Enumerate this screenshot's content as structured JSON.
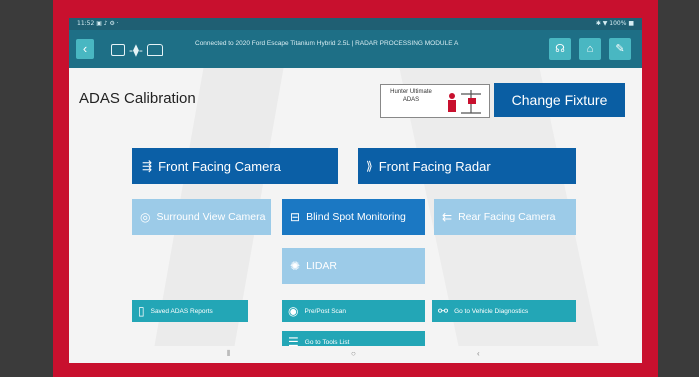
{
  "statusbar": {
    "left": "11:52 ▣ ♪ ⚙ ·",
    "right": "✱ ▼ 100% ■"
  },
  "header": {
    "back_glyph": "‹",
    "connection_text": "Connected to 2020 Ford Escape Titanium Hybrid 2.5L | RADAR PROCESSING MODULE A",
    "buttons": [
      {
        "icon": "headset-icon",
        "glyph": "☊"
      },
      {
        "icon": "home-icon",
        "glyph": "⌂"
      },
      {
        "icon": "report-icon",
        "glyph": "✎"
      }
    ]
  },
  "main": {
    "title": "ADAS Calibration",
    "fixture": {
      "label": "Hunter Ultimate ADAS",
      "change_label": "Change Fixture"
    },
    "buttons": {
      "front_camera": "Front Facing Camera",
      "front_radar": "Front Facing Radar",
      "surround_view": "Surround View Camera",
      "blind_spot": "Blind Spot Monitoring",
      "rear_camera": "Rear Facing Camera",
      "lidar": "LIDAR",
      "saved_reports": "Saved ADAS Reports",
      "pre_post_scan": "Pre/Post Scan",
      "vehicle_diagnostics": "Go to Vehicle Diagnostics",
      "tools_list": "Go to Tools List"
    }
  },
  "navbar": {
    "recent": "⦀",
    "home": "○",
    "back": "‹"
  },
  "colors": {
    "brand_red": "#c8102e",
    "header_teal": "#1e6f86",
    "button_blue": "#0b5fa6",
    "button_teal": "#23a6b6"
  }
}
